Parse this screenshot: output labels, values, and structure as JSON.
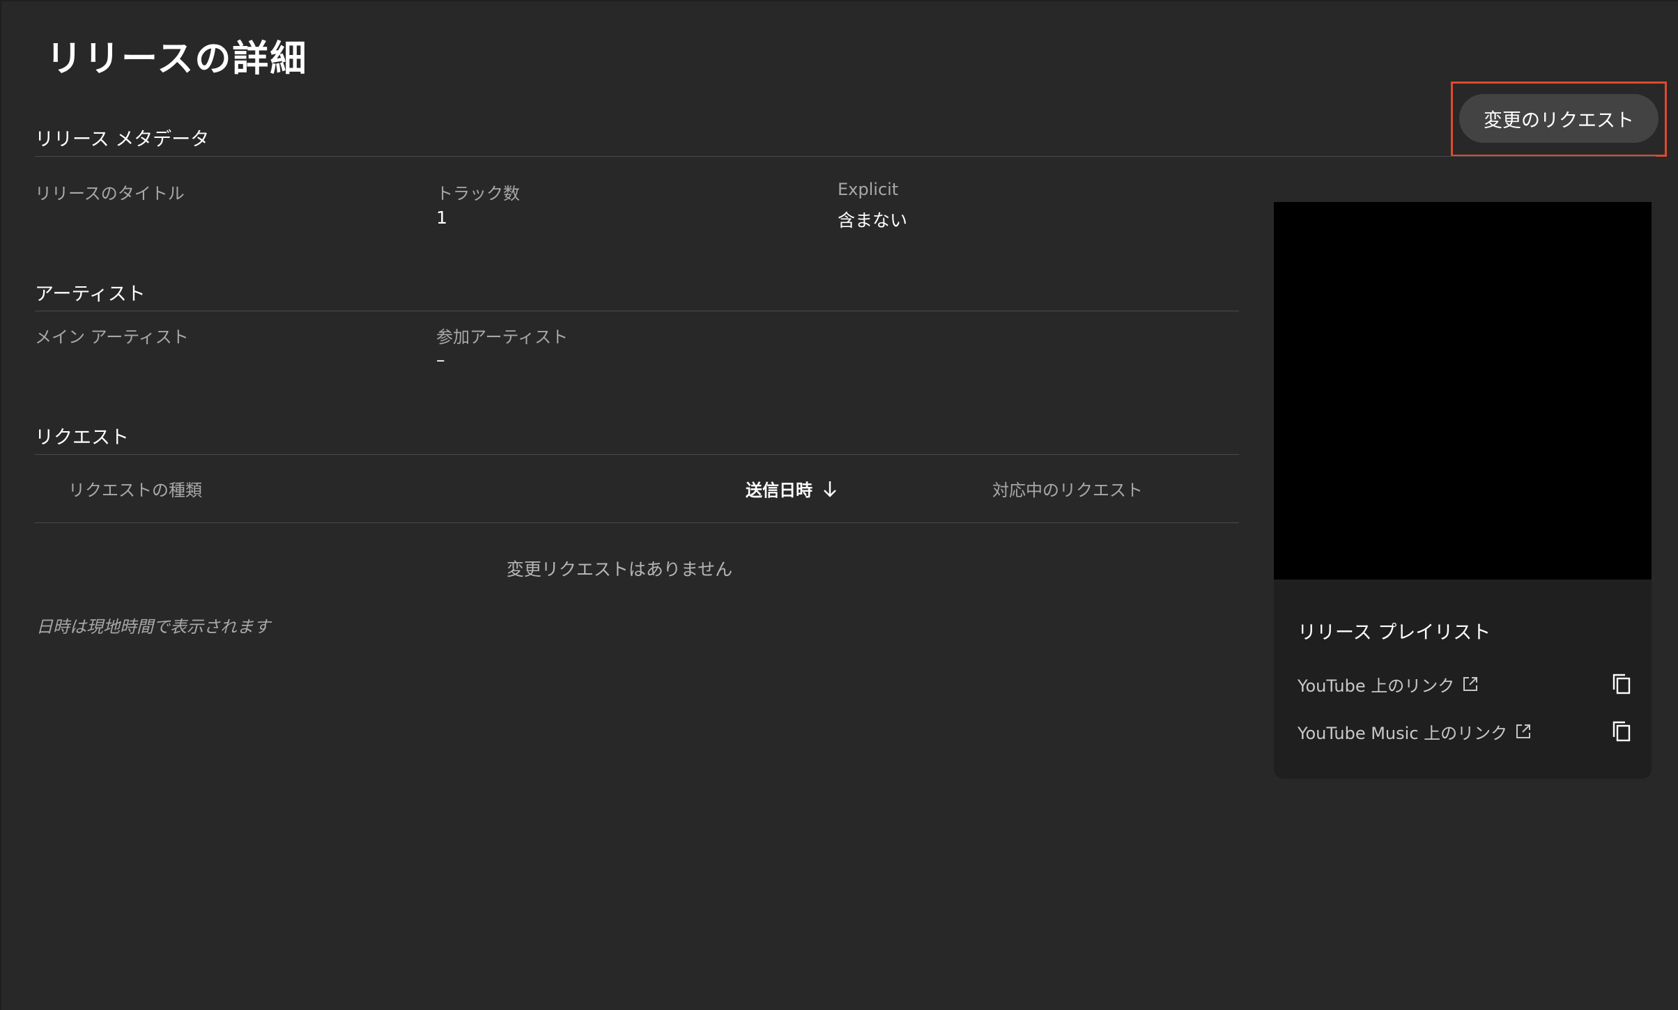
{
  "page_title": "リリースの詳細",
  "actions": {
    "request_change_label": "変更のリクエスト"
  },
  "metadata": {
    "section_title": "リリース メタデータ",
    "fields": [
      {
        "label": "リリースのタイトル",
        "value": ""
      },
      {
        "label": "トラック数",
        "value": "1"
      },
      {
        "label": "Explicit",
        "value": "含まない"
      }
    ]
  },
  "artists": {
    "section_title": "アーティスト",
    "fields": [
      {
        "label": "メイン アーティスト",
        "value": ""
      },
      {
        "label": "参加アーティスト",
        "value": "–"
      }
    ]
  },
  "requests": {
    "section_title": "リクエスト",
    "columns": [
      {
        "label": "リクエストの種類"
      },
      {
        "label": "送信日時",
        "sorted": "descending"
      },
      {
        "label": "対応中のリクエスト"
      }
    ],
    "empty_message": "変更リクエストはありません",
    "timezone_note": "日時は現地時間で表示されます"
  },
  "side_panel": {
    "playlist_title": "リリース プレイリスト",
    "links": [
      {
        "label": "YouTube 上のリンク"
      },
      {
        "label": "YouTube Music 上のリンク"
      }
    ]
  },
  "colors": {
    "background": "#282828",
    "highlight_border": "#e0492e",
    "button_bg": "#434343"
  },
  "icons": [
    "arrow-down-icon",
    "external-link-icon",
    "copy-icon"
  ]
}
